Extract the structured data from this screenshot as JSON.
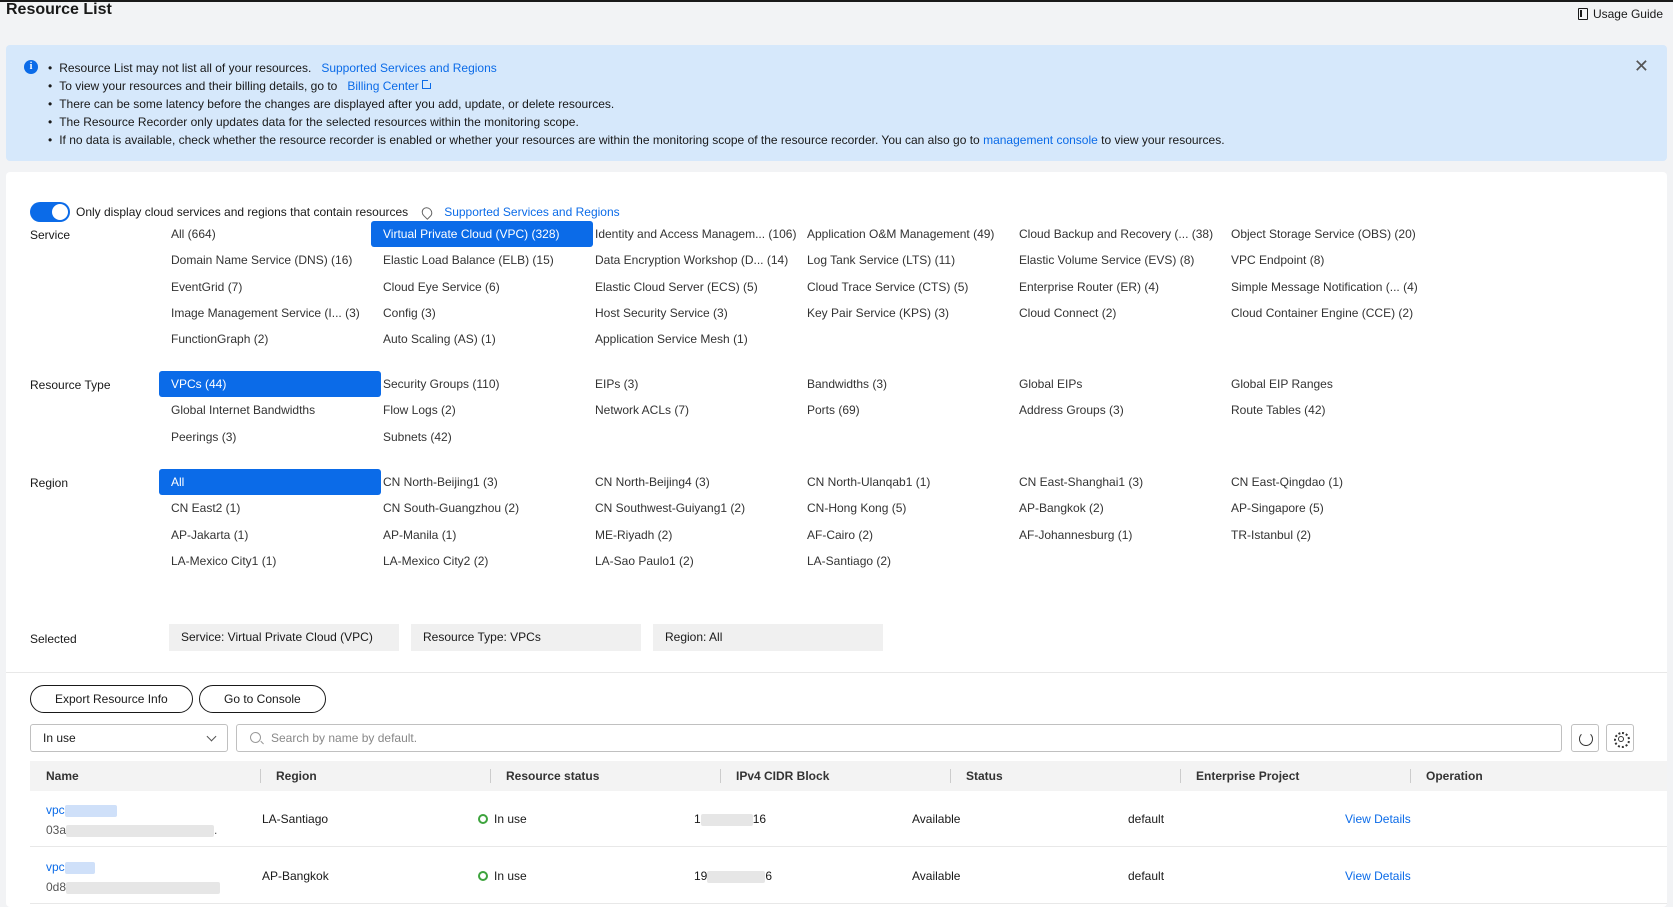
{
  "header": {
    "title": "Resource List",
    "usage_guide": "Usage Guide"
  },
  "notice": {
    "line1": "Resource List may not list all of your resources.",
    "line1_link": "Supported Services and Regions",
    "line2": "To view your resources and their billing details, go to",
    "line2_link": "Billing Center",
    "line3": "There can be some latency before the changes are displayed after you add, update, or delete resources.",
    "line4": "The Resource Recorder only updates data for the selected resources within the monitoring scope.",
    "line5": "If no data is available, check whether the resource recorder is enabled or whether your resources are within the monitoring scope of the resource recorder. You can also go to",
    "line5_link": "management console",
    "line5_tail": "to view your resources."
  },
  "toggle": {
    "label": "Only display cloud services and regions that contain resources",
    "link": "Supported Services and Regions",
    "on": true
  },
  "filters": {
    "service_label": "Service",
    "services": [
      "All (664)",
      "Virtual Private Cloud (VPC) (328)",
      "Identity and Access Managem...  (106)",
      "Application O&M Management (49)",
      "Cloud Backup and Recovery (...  (38)",
      "Object Storage Service (OBS) (20)",
      "Domain Name Service (DNS) (16)",
      "Elastic Load Balance (ELB) (15)",
      "Data Encryption Workshop (D...  (14)",
      "Log Tank Service (LTS) (11)",
      "Elastic Volume Service (EVS) (8)",
      "VPC Endpoint (8)",
      "EventGrid (7)",
      "Cloud Eye Service (6)",
      "Elastic Cloud Server (ECS) (5)",
      "Cloud Trace Service (CTS) (5)",
      "Enterprise Router (ER) (4)",
      "Simple Message Notification (...  (4)",
      "Image Management Service (I...  (3)",
      "Config (3)",
      "Host Security Service (3)",
      "Key Pair Service (KPS) (3)",
      "Cloud Connect (2)",
      "Cloud Container Engine (CCE) (2)",
      "FunctionGraph (2)",
      "Auto Scaling (AS) (1)",
      "Application Service Mesh (1)"
    ],
    "resource_type_label": "Resource Type",
    "resource_types": [
      "VPCs (44)",
      "Security Groups (110)",
      "EIPs (3)",
      "Bandwidths (3)",
      "Global EIPs",
      "Global EIP Ranges",
      "Global Internet Bandwidths",
      "Flow Logs (2)",
      "Network ACLs (7)",
      "Ports (69)",
      "Address Groups (3)",
      "Route Tables (42)",
      "Peerings (3)",
      "Subnets (42)"
    ],
    "region_label": "Region",
    "regions": [
      "All",
      "CN North-Beijing1 (3)",
      "CN North-Beijing4 (3)",
      "CN North-Ulanqab1 (1)",
      "CN East-Shanghai1 (3)",
      "CN East-Qingdao (1)",
      "CN East2 (1)",
      "CN South-Guangzhou (2)",
      "CN Southwest-Guiyang1 (2)",
      "CN-Hong Kong (5)",
      "AP-Bangkok (2)",
      "AP-Singapore (5)",
      "AP-Jakarta (1)",
      "AP-Manila (1)",
      "ME-Riyadh (2)",
      "AF-Cairo (2)",
      "AF-Johannesburg (1)",
      "TR-Istanbul (2)",
      "LA-Mexico City1 (1)",
      "LA-Mexico City2 (2)",
      "LA-Sao Paulo1 (2)",
      "LA-Santiago (2)"
    ],
    "selected_label": "Selected",
    "selected": [
      "Service: Virtual Private Cloud (VPC)",
      "Resource Type: VPCs",
      "Region: All"
    ]
  },
  "toolbar": {
    "export_label": "Export Resource Info",
    "console_label": "Go to Console",
    "status_select": "In use",
    "search_placeholder": "Search by name by default."
  },
  "table": {
    "columns": [
      "Name",
      "Region",
      "Resource status",
      "IPv4 CIDR Block",
      "Status",
      "Enterprise Project",
      "Operation"
    ],
    "rows": [
      {
        "name": "vpc",
        "id": "03a",
        "id_tail": ".",
        "region": "LA-Santiago",
        "resource_status": "In use",
        "cidr_head": "1",
        "cidr_tail": "16",
        "status": "Available",
        "project": "default",
        "operation": "View Details"
      },
      {
        "name": "vpc",
        "id": "0d8",
        "id_tail": "",
        "region": "AP-Bangkok",
        "resource_status": "In use",
        "cidr_head": "19",
        "cidr_tail": "6",
        "status": "Available",
        "project": "default",
        "operation": "View Details"
      }
    ]
  },
  "colors": {
    "accent": "#0b6be8",
    "notice_bg": "#d6e8fb",
    "status_green": "#3da33d"
  }
}
